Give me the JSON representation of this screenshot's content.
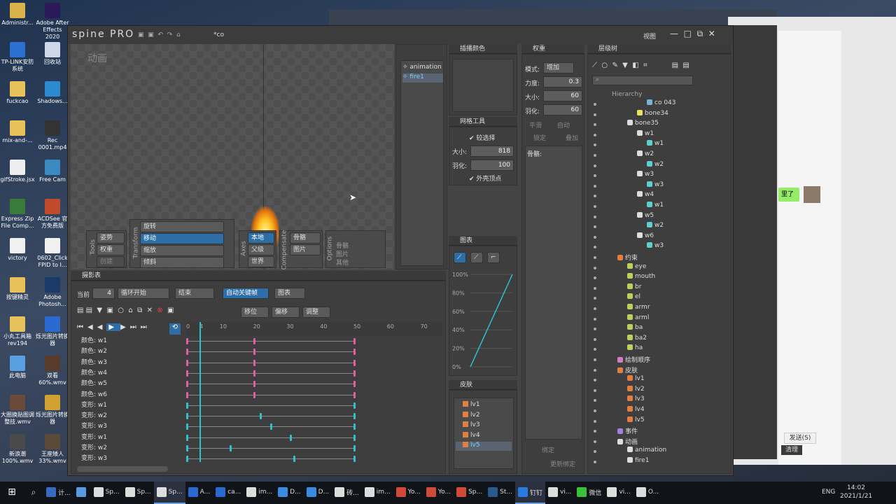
{
  "desktop_icons": [
    {
      "label": "Administr...",
      "color": "#d9b24a"
    },
    {
      "label": "TP-LINK安防系统",
      "color": "#2b6fd1"
    },
    {
      "label": "fuckcao",
      "color": "#e7c15a"
    },
    {
      "label": "mix-and-...",
      "color": "#e7c15a"
    },
    {
      "label": "gifStroke.jsx",
      "color": "#eeeeee"
    },
    {
      "label": "Express Zip File Comp...",
      "color": "#3a7a3a"
    },
    {
      "label": "victory",
      "color": "#f0f0f0"
    },
    {
      "label": "按键精灵",
      "color": "#e7c15a"
    },
    {
      "label": "小丸工具箱 rev194",
      "color": "#e7c15a"
    },
    {
      "label": "此电脑",
      "color": "#5aa0e0"
    },
    {
      "label": "大圈换贴图调整技.wmv",
      "color": "#6a4a3a"
    },
    {
      "label": "新浪潮 100%.wmv",
      "color": "#4a4a4a"
    }
  ],
  "desktop_icons2": [
    {
      "label": "Adobe After Effects 2020",
      "color": "#2a1a5a"
    },
    {
      "label": "回收站",
      "color": "#cfd8e8"
    },
    {
      "label": "Shadows...",
      "color": "#2b8ad0"
    },
    {
      "label": "Rec 0001.mp4",
      "color": "#333333"
    },
    {
      "label": "Free Cam",
      "color": "#3a8ac0"
    },
    {
      "label": "ACDSee 官方免费版",
      "color": "#c04a2a"
    },
    {
      "label": "0602_Click FPID to I...",
      "color": "#f0f0f0"
    },
    {
      "label": "Adobe Photosh...",
      "color": "#1a3a6a"
    },
    {
      "label": "烁光图片转换器",
      "color": "#2a6ad0"
    },
    {
      "label": "双看 60%.wmv",
      "color": "#5a3a2a"
    },
    {
      "label": "烁光图片转换器",
      "color": "#d0a030"
    },
    {
      "label": "王座矮人 33%.wmv",
      "color": "#5a4a3a"
    }
  ],
  "spine": {
    "title_logo": "spine PRO",
    "project_name": "*co",
    "views_label": "视图",
    "viewport_mode": "动画",
    "tools_label": "Tools",
    "tools": [
      "姿势",
      "权重",
      "创建"
    ],
    "transform_label": "Transform",
    "transform": [
      "旋转",
      "移动",
      "缩放",
      "倾斜"
    ],
    "axes_label": "Axes",
    "axes": [
      "本地",
      "父级",
      "世界"
    ],
    "compensate_label": "Compensate",
    "compensate": [
      "骨骼",
      "图片"
    ],
    "options_label": "Options",
    "options": [
      "骨骼",
      "图片",
      "其他"
    ],
    "anim_list": [
      "animation",
      "fire1"
    ],
    "interp_title": "插播颜色",
    "mesh_title": "网格工具",
    "mesh": {
      "soft_select": "较选择",
      "size_label": "大小:",
      "size": "818",
      "feather_label": "羽化:",
      "feather": "100",
      "hull": "外壳顶点"
    },
    "graph_title": "图表",
    "graph": {
      "y_ticks": [
        "100%",
        "80%",
        "60%",
        "40%",
        "20%",
        "0%"
      ],
      "curve": [
        [
          0,
          0
        ],
        [
          1,
          1
        ]
      ]
    },
    "skins_title": "皮肤",
    "skins": [
      "lv1",
      "lv2",
      "lv3",
      "lv4",
      "lv5"
    ],
    "weights_title": "权重",
    "weights": {
      "mode_label": "模式:",
      "mode": "增加",
      "strength_label": "力度:",
      "strength": "0.3",
      "size_label": "大小:",
      "size": "60",
      "feather_label": "羽化:",
      "feather": "60",
      "smooth": "平滑",
      "auto": "自动",
      "pin": "锁定",
      "overlay": "叠加",
      "bones_label": "骨骼:",
      "lock": "绑定",
      "update": "更新绑定"
    },
    "tree_title": "层级树",
    "hierarchy_label": "Hierarchy",
    "tree": [
      {
        "t": "co 043",
        "d": 5,
        "c": "#7fb0d0"
      },
      {
        "t": "bone34",
        "d": 4,
        "c": "#f0e060"
      },
      {
        "t": "bone35",
        "d": 3,
        "c": "#ddd"
      },
      {
        "t": "w1",
        "d": 4,
        "c": "#ddd"
      },
      {
        "t": "w1",
        "d": 5,
        "c": "#5ad0d0"
      },
      {
        "t": "w2",
        "d": 4,
        "c": "#ddd"
      },
      {
        "t": "w2",
        "d": 5,
        "c": "#5ad0d0"
      },
      {
        "t": "w3",
        "d": 4,
        "c": "#ddd"
      },
      {
        "t": "w3",
        "d": 5,
        "c": "#5ad0d0"
      },
      {
        "t": "w4",
        "d": 4,
        "c": "#ddd"
      },
      {
        "t": "w1",
        "d": 5,
        "c": "#5ad0d0"
      },
      {
        "t": "w5",
        "d": 4,
        "c": "#ddd"
      },
      {
        "t": "w2",
        "d": 5,
        "c": "#5ad0d0"
      },
      {
        "t": "w6",
        "d": 4,
        "c": "#ddd"
      },
      {
        "t": "w3",
        "d": 5,
        "c": "#5ad0d0"
      },
      {
        "t": "约束",
        "d": 2,
        "c": "#e08040"
      },
      {
        "t": "eye",
        "d": 3,
        "c": "#c0d060"
      },
      {
        "t": "mouth",
        "d": 3,
        "c": "#c0d060"
      },
      {
        "t": "br",
        "d": 3,
        "c": "#c0d060"
      },
      {
        "t": "el",
        "d": 3,
        "c": "#c0d060"
      },
      {
        "t": "armr",
        "d": 3,
        "c": "#c0d060"
      },
      {
        "t": "arml",
        "d": 3,
        "c": "#c0d060"
      },
      {
        "t": "ba",
        "d": 3,
        "c": "#c0d060"
      },
      {
        "t": "ba2",
        "d": 3,
        "c": "#c0d060"
      },
      {
        "t": "ha",
        "d": 3,
        "c": "#c0d060"
      },
      {
        "t": "绘制顺序",
        "d": 2,
        "c": "#d080c0"
      },
      {
        "t": "皮肤",
        "d": 2,
        "c": "#e08040"
      },
      {
        "t": "lv1",
        "d": 3,
        "c": "#e08040"
      },
      {
        "t": "lv2",
        "d": 3,
        "c": "#e08040"
      },
      {
        "t": "lv3",
        "d": 3,
        "c": "#e08040"
      },
      {
        "t": "lv4",
        "d": 3,
        "c": "#e08040"
      },
      {
        "t": "lv5",
        "d": 3,
        "c": "#e08040"
      },
      {
        "t": "事件",
        "d": 2,
        "c": "#a080e0"
      },
      {
        "t": "动画",
        "d": 2,
        "c": "#ddd"
      },
      {
        "t": "animation",
        "d": 3,
        "c": "#ddd"
      },
      {
        "t": "fire1",
        "d": 3,
        "c": "#ddd"
      }
    ],
    "dopesheet_title": "摄影表",
    "ds": {
      "current_label": "当前",
      "current": "4",
      "loop_label": "循环开始",
      "end_label": "结束",
      "autokey": "自动关键帧",
      "graph_btn": "图表",
      "offset": "移位",
      "shift": "偏移",
      "adjust": "调整"
    },
    "ruler": [
      "0",
      "4",
      "10",
      "20",
      "30",
      "40",
      "50",
      "60",
      "70"
    ],
    "tracks": [
      {
        "n": "颜色: w1",
        "k": [
          [
            0,
            "#e060a0"
          ],
          [
            20,
            "#e060a0"
          ],
          [
            50,
            "#e060a0"
          ]
        ]
      },
      {
        "n": "颜色: w2",
        "k": [
          [
            0,
            "#e060a0"
          ],
          [
            20,
            "#e060a0"
          ],
          [
            50,
            "#e060a0"
          ]
        ]
      },
      {
        "n": "颜色: w3",
        "k": [
          [
            0,
            "#e060a0"
          ],
          [
            20,
            "#e060a0"
          ],
          [
            50,
            "#e060a0"
          ]
        ]
      },
      {
        "n": "颜色: w4",
        "k": [
          [
            0,
            "#e060a0"
          ],
          [
            20,
            "#e060a0"
          ],
          [
            50,
            "#e060a0"
          ]
        ]
      },
      {
        "n": "颜色: w5",
        "k": [
          [
            0,
            "#e060a0"
          ],
          [
            20,
            "#e060a0"
          ],
          [
            50,
            "#e060a0"
          ]
        ]
      },
      {
        "n": "颜色: w6",
        "k": [
          [
            0,
            "#e060a0"
          ],
          [
            20,
            "#e060a0"
          ],
          [
            50,
            "#e060a0"
          ]
        ]
      },
      {
        "n": "变形: w1",
        "k": [
          [
            0,
            "#30c0d0"
          ],
          [
            50,
            "#30c0d0"
          ]
        ]
      },
      {
        "n": "变形: w2",
        "k": [
          [
            0,
            "#30c0d0"
          ],
          [
            22,
            "#30c0d0"
          ],
          [
            50,
            "#30c0d0"
          ]
        ]
      },
      {
        "n": "变形: w3",
        "k": [
          [
            0,
            "#30c0d0"
          ],
          [
            25,
            "#30c0d0"
          ],
          [
            50,
            "#30c0d0"
          ]
        ]
      },
      {
        "n": "变形: w1",
        "k": [
          [
            0,
            "#30c0d0"
          ],
          [
            31,
            "#30c0d0"
          ],
          [
            50,
            "#30c0d0"
          ]
        ]
      },
      {
        "n": "变形: w2",
        "k": [
          [
            0,
            "#30c0d0"
          ],
          [
            13,
            "#30c0d0"
          ],
          [
            50,
            "#30c0d0"
          ]
        ]
      },
      {
        "n": "变形: w3",
        "k": [
          [
            0,
            "#30c0d0"
          ],
          [
            32,
            "#30c0d0"
          ],
          [
            50,
            "#30c0d0"
          ]
        ]
      }
    ]
  },
  "chat": {
    "bubble": "里了",
    "send": "发送(S)",
    "clear": "清理"
  },
  "taskbar": {
    "items": [
      {
        "l": "计...",
        "c": "#3a6ac0"
      },
      {
        "l": "",
        "c": "#5a9ae0"
      },
      {
        "l": "Sp...",
        "c": "#ddd"
      },
      {
        "l": "Sp...",
        "c": "#ddd"
      },
      {
        "l": "Sp...",
        "c": "#ddd",
        "active": true
      },
      {
        "l": "A...",
        "c": "#2a6ad0"
      },
      {
        "l": "ca...",
        "c": "#2a6ad0"
      },
      {
        "l": "im...",
        "c": "#ddd"
      },
      {
        "l": "D...",
        "c": "#3a8ae0"
      },
      {
        "l": "D...",
        "c": "#3a8ae0"
      },
      {
        "l": "砖...",
        "c": "#ddd"
      },
      {
        "l": "im...",
        "c": "#ddd"
      },
      {
        "l": "Yo...",
        "c": "#d04a3a"
      },
      {
        "l": "Yo...",
        "c": "#d04a3a"
      },
      {
        "l": "Sp...",
        "c": "#d04a3a"
      },
      {
        "l": "St...",
        "c": "#2a5a8a"
      },
      {
        "l": "钉钉",
        "c": "#2a7ae0",
        "active": true
      },
      {
        "l": "vi...",
        "c": "#ddd"
      },
      {
        "l": "微信",
        "c": "#3ac03a"
      },
      {
        "l": "vi...",
        "c": "#ddd"
      },
      {
        "l": "O...",
        "c": "#ddd"
      }
    ],
    "lang": "ENG",
    "time": "14:02",
    "date": "2021/1/21"
  }
}
